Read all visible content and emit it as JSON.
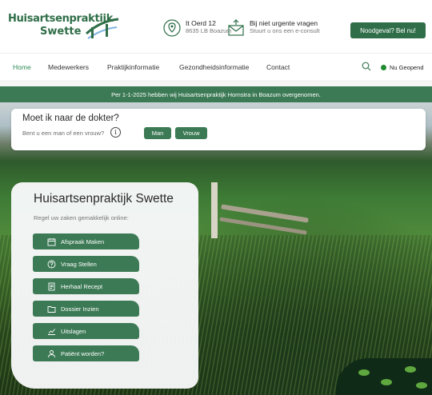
{
  "header": {
    "logo_line1": "Huisartsenpraktijk",
    "logo_line2": "Swette",
    "address_line1": "It Oerd 12",
    "address_line2": "8635 LB Boazum",
    "consult_line1": "Bij niet urgente vragen",
    "consult_line2": "Stuurt u ons een e-consult",
    "emergency_button": "Noodgeval? Bel nu!"
  },
  "nav": {
    "items": [
      {
        "label": "Home"
      },
      {
        "label": "Medewerkers"
      },
      {
        "label": "Praktijkinformatie"
      },
      {
        "label": "Gezondheidsinformatie"
      },
      {
        "label": "Contact"
      }
    ],
    "status": "Nu Geopend"
  },
  "announcement": "Per 1-1-2025 hebben wij Huisartsenpraktijk Hornstra in Boazum overgenomen.",
  "doctor_question": {
    "title": "Moet ik naar de dokter?",
    "subtitle": "Bent u een man of een vrouw?",
    "info_symbol": "i",
    "options": [
      "Man",
      "Vrouw"
    ]
  },
  "practice_card": {
    "title": "Huisartsenpraktijk Swette",
    "subtitle": "Regel uw zaken gemakkelijk online:",
    "actions": [
      {
        "label": "Afspraak Maken",
        "icon": "calendar-icon"
      },
      {
        "label": "Vraag Stellen",
        "icon": "question-icon"
      },
      {
        "label": "Herhaal Recept",
        "icon": "prescription-icon"
      },
      {
        "label": "Dossier Inzien",
        "icon": "folder-icon"
      },
      {
        "label": "Uitslagen",
        "icon": "results-icon"
      },
      {
        "label": "Patiënt worden?",
        "icon": "patient-icon"
      }
    ]
  },
  "colors": {
    "brand_green": "#3c7a55",
    "status_open": "#1f8b2f",
    "nav_active": "#2f8a57"
  }
}
